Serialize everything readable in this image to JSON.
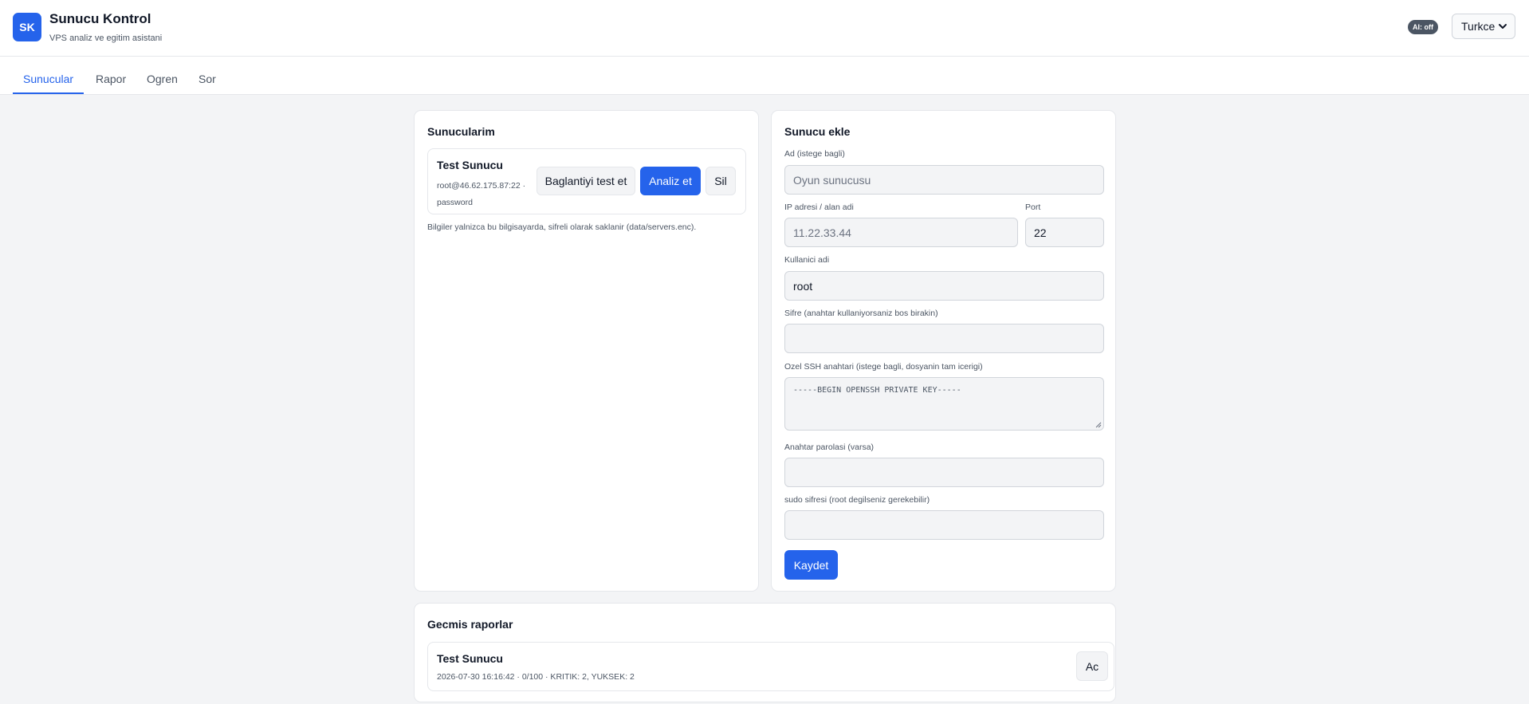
{
  "header": {
    "logo_text": "SK",
    "title": "Sunucu Kontrol",
    "subtitle": "VPS analiz ve egitim asistani",
    "ai_badge": "AI: off",
    "language": "Turkce"
  },
  "tabs": [
    {
      "label": "Sunucular",
      "active": true
    },
    {
      "label": "Rapor",
      "active": false
    },
    {
      "label": "Ogren",
      "active": false
    },
    {
      "label": "Sor",
      "active": false
    }
  ],
  "servers": {
    "title": "Sunucularim",
    "items": [
      {
        "name": "Test Sunucu",
        "meta": "root@46.62.175.87:22 · password",
        "test_label": "Baglantiyi test et",
        "analyze_label": "Analiz et",
        "delete_label": "Sil"
      }
    ],
    "note": "Bilgiler yalnizca bu bilgisayarda, sifreli olarak saklanir (data/servers.enc)."
  },
  "add_server": {
    "title": "Sunucu ekle",
    "name_label": "Ad (istege bagli)",
    "name_placeholder": "Oyun sunucusu",
    "ip_label": "IP adresi / alan adi",
    "ip_placeholder": "11.22.33.44",
    "port_label": "Port",
    "port_value": "22",
    "user_label": "Kullanici adi",
    "user_value": "root",
    "password_label": "Sifre (anahtar kullaniyorsaniz bos birakin)",
    "password_value": "",
    "ssh_key_label": "Ozel SSH anahtari (istege bagli, dosyanin tam icerigi)",
    "ssh_key_placeholder": "-----BEGIN OPENSSH PRIVATE KEY-----",
    "passphrase_label": "Anahtar parolasi (varsa)",
    "passphrase_value": "",
    "sudo_label": "sudo sifresi (root degilseniz gerekebilir)",
    "sudo_value": "",
    "save_label": "Kaydet"
  },
  "reports": {
    "title": "Gecmis raporlar",
    "items": [
      {
        "name": "Test Sunucu",
        "meta": "2026-07-30 16:16:42 · 0/100 · KRITIK: 2, YUKSEK: 2",
        "open_label": "Ac"
      }
    ]
  },
  "colors": {
    "accent": "#2563eb",
    "background": "#f3f4f6",
    "badge": "#4b5563"
  }
}
